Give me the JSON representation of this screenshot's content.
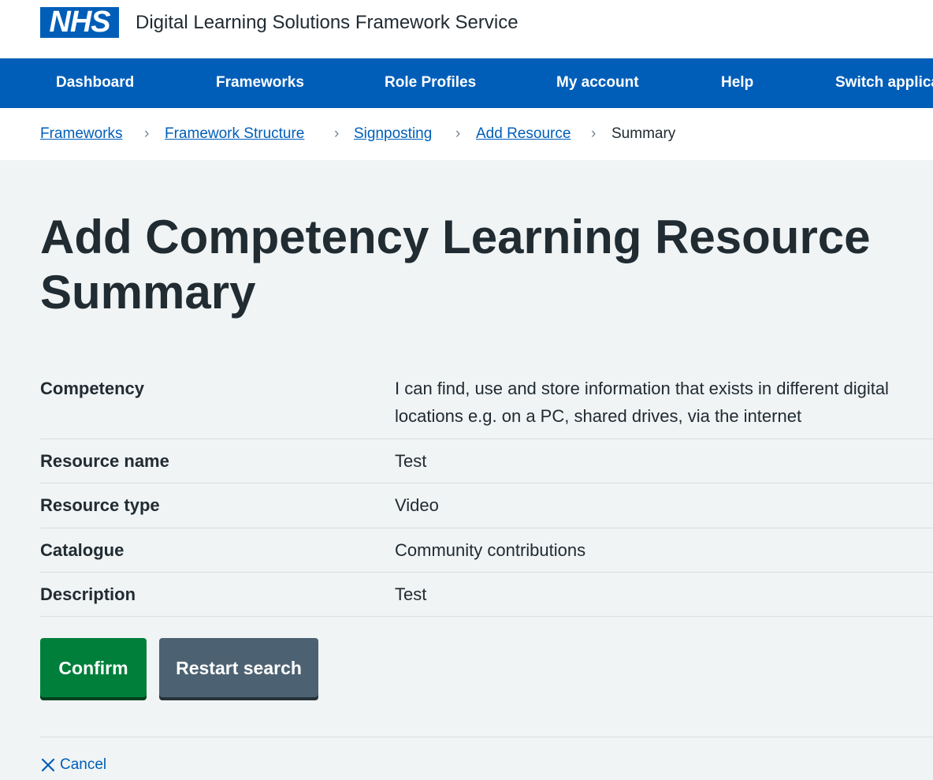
{
  "header": {
    "logo_text": "NHS",
    "service_name": "Digital Learning Solutions Framework Service"
  },
  "nav": {
    "items": [
      "Dashboard",
      "Frameworks",
      "Role Profiles",
      "My account",
      "Help",
      "Switch application"
    ]
  },
  "breadcrumb": {
    "items": [
      "Frameworks",
      "Framework Structure",
      "Signposting",
      "Add Resource"
    ],
    "current": "Summary"
  },
  "page": {
    "title": "Add Competency Learning Resource Summary"
  },
  "summary": {
    "rows": [
      {
        "key": "Competency",
        "value": "I can find, use and store information that exists in different digital locations e.g. on a PC, shared drives, via the internet"
      },
      {
        "key": "Resource name",
        "value": "Test"
      },
      {
        "key": "Resource type",
        "value": "Video"
      },
      {
        "key": "Catalogue",
        "value": "Community contributions"
      },
      {
        "key": "Description",
        "value": "Test"
      }
    ]
  },
  "actions": {
    "confirm_label": "Confirm",
    "restart_label": "Restart search",
    "cancel_label": "Cancel"
  },
  "colors": {
    "nhs_blue": "#005eb8",
    "confirm_green": "#007f3b",
    "secondary_grey": "#4c6272",
    "background": "#f0f4f5"
  },
  "icons": {
    "cancel": "close-icon",
    "breadcrumb_separator": "chevron-right-icon"
  }
}
